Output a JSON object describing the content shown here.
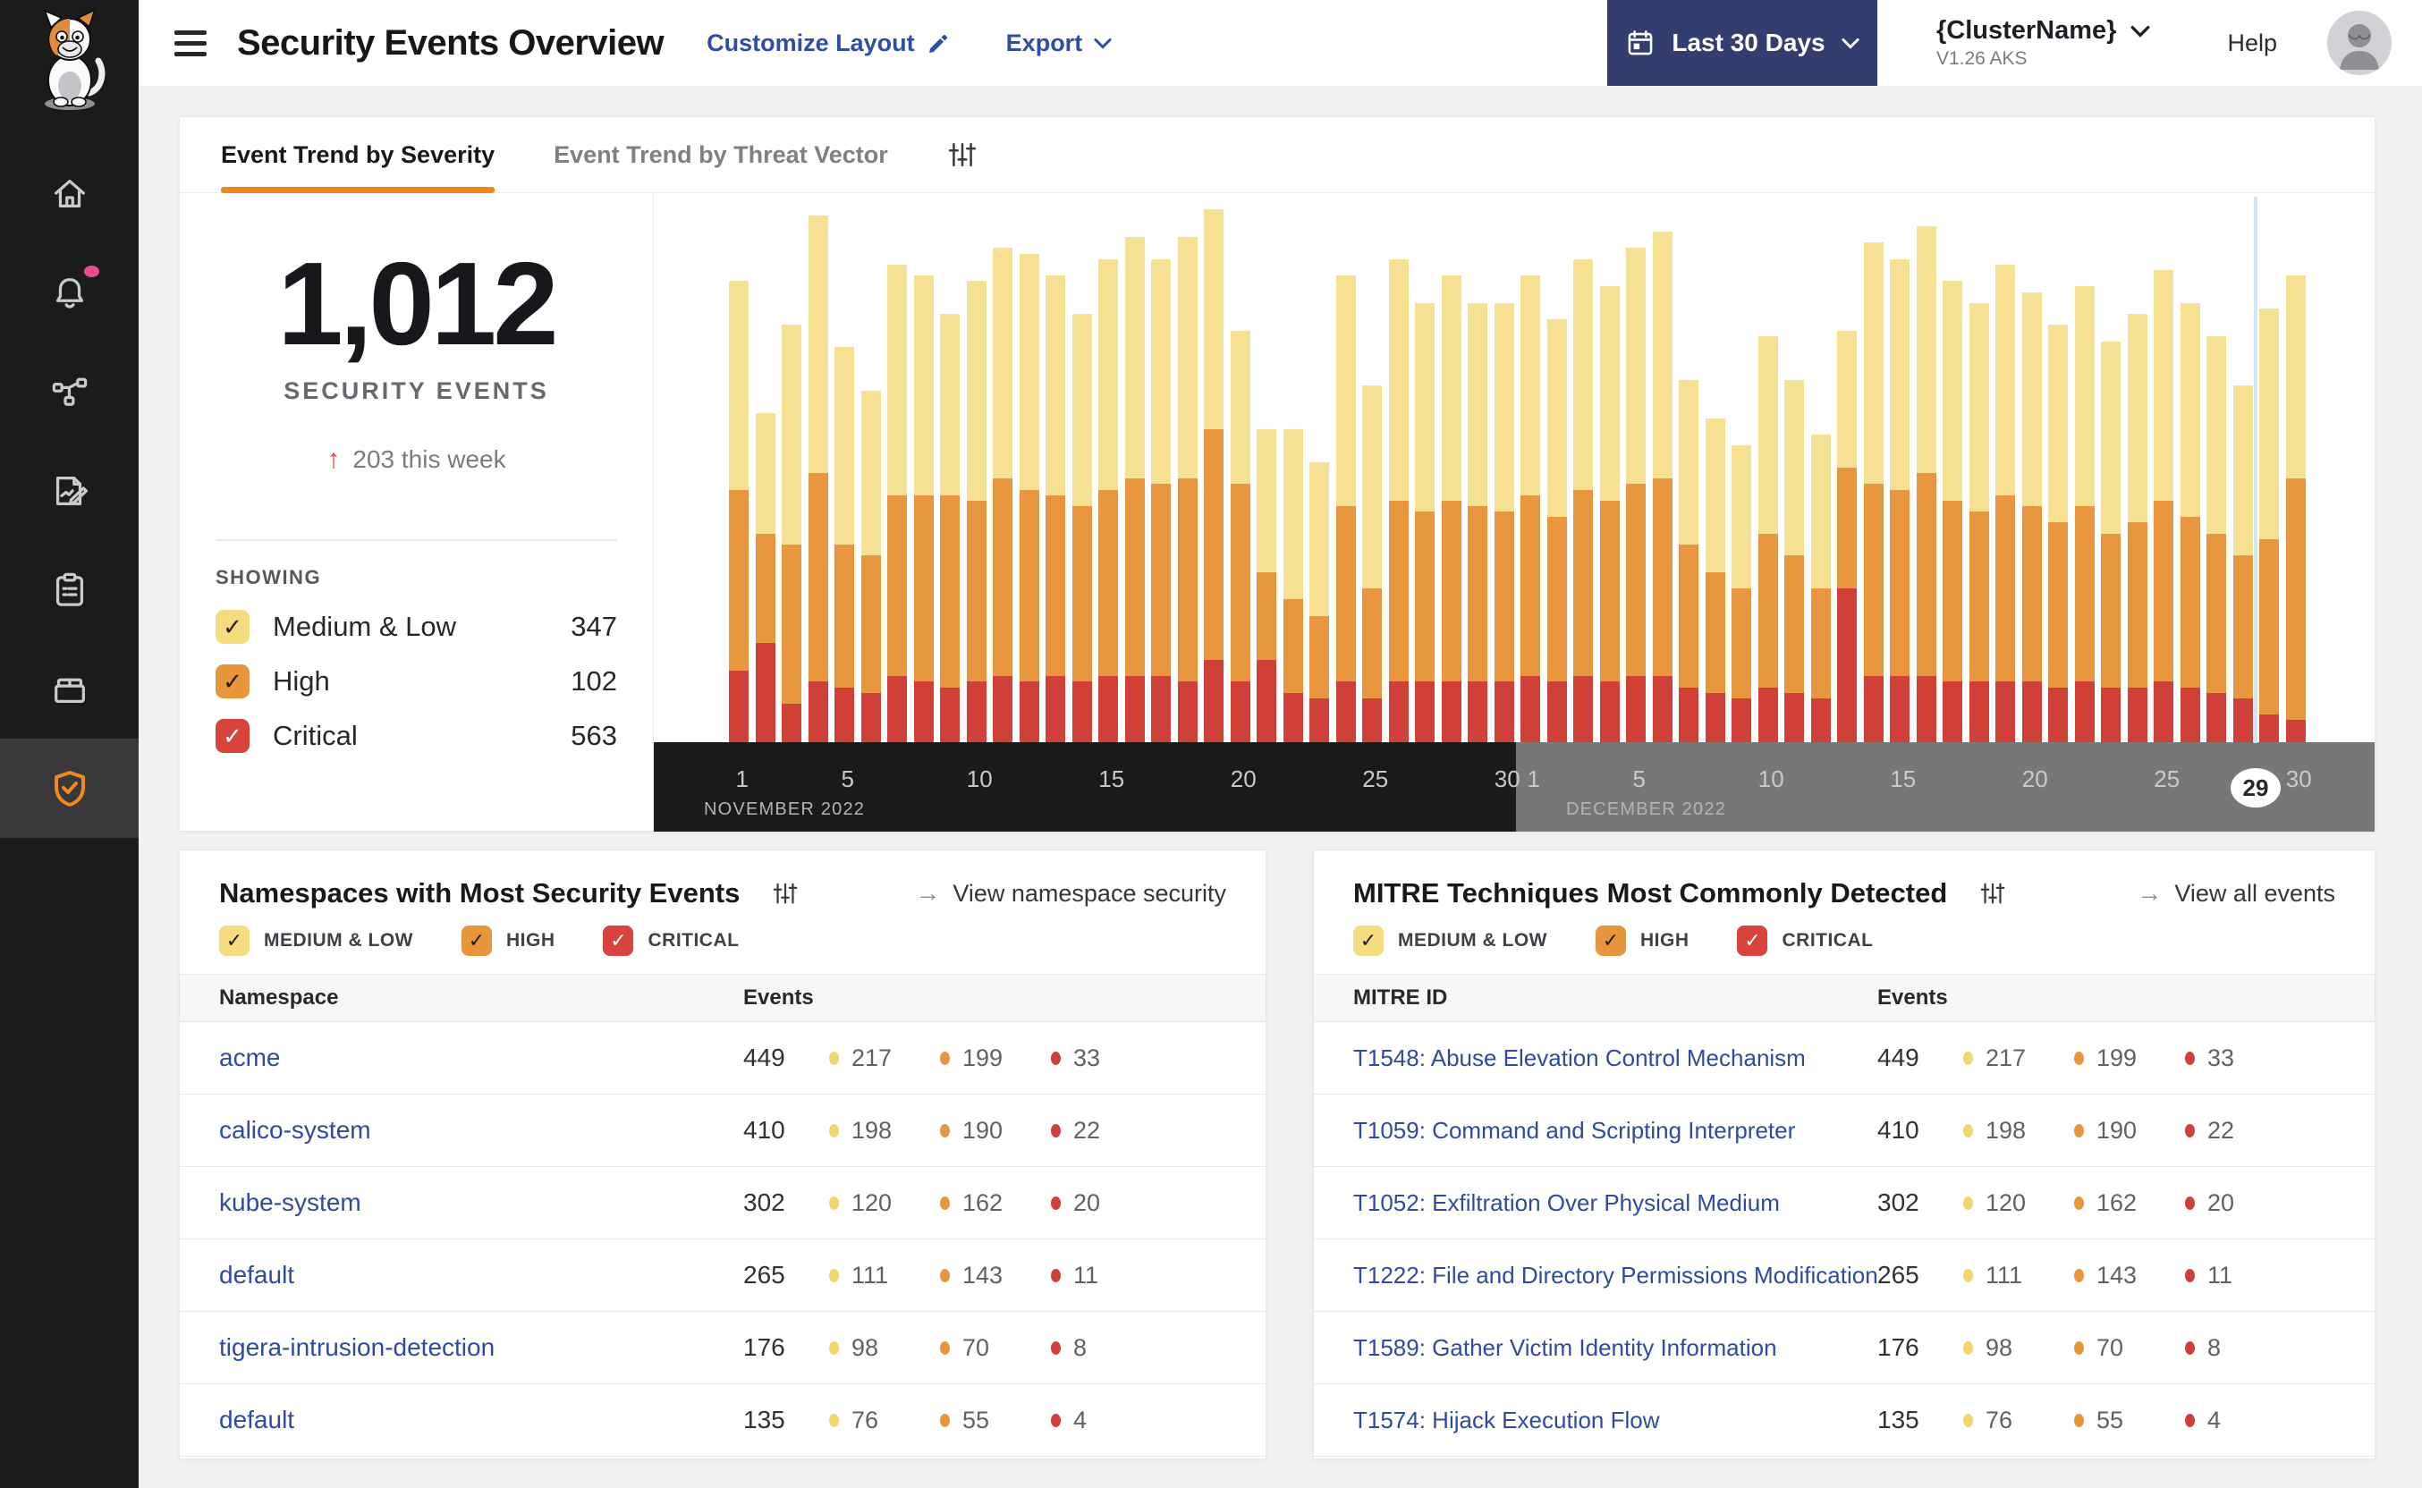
{
  "header": {
    "title": "Security Events Overview",
    "customize_label": "Customize Layout",
    "export_label": "Export",
    "date_range_label": "Last 30 Days",
    "cluster_name": "{ClusterName}",
    "cluster_version": "V1.26 AKS",
    "help_label": "Help"
  },
  "sidebar": {
    "icons": [
      "calico-cat-logo",
      "home",
      "alerts-bell",
      "service-graph",
      "report-edit",
      "clipboard",
      "workload-box",
      "threat-defense-shield"
    ],
    "active_icon": "threat-defense-shield"
  },
  "tabs": {
    "severity": "Event Trend by Severity",
    "threat_vector": "Event Trend by Threat Vector"
  },
  "stats": {
    "total": "1,012",
    "total_label": "SECURITY EVENTS",
    "delta_arrow": "↑",
    "delta_text": "203 this week",
    "showing_label": "SHOWING",
    "rows": [
      {
        "id": "medium_low",
        "label": "Medium & Low",
        "value": "347"
      },
      {
        "id": "high",
        "label": "High",
        "value": "102"
      },
      {
        "id": "critical",
        "label": "Critical",
        "value": "563"
      }
    ]
  },
  "severity_filters": [
    {
      "id": "medium_low",
      "label": "MEDIUM & LOW",
      "box": "#F5DC7E",
      "check": "#1D1D1D",
      "checked": true
    },
    {
      "id": "high",
      "label": "HIGH",
      "box": "#E8963C",
      "check": "#1D1D1D",
      "checked": true
    },
    {
      "id": "critical",
      "label": "CRITICAL",
      "box": "#D8433C",
      "check": "#FFFFFF",
      "checked": true
    }
  ],
  "chart_data": {
    "type": "bar",
    "subtype": "stacked_daily",
    "title": "Event Trend by Severity",
    "unit": "percent_of_plot_height",
    "stack_order_bottom_to_top": [
      "critical",
      "high",
      "medium_low"
    ],
    "legend": {
      "medium_low": "Medium & Low",
      "high": "High",
      "critical": "Critical"
    },
    "months": [
      {
        "label": "NOVEMBER 2022",
        "days": 30,
        "ticks": [
          1,
          5,
          10,
          15,
          20,
          25,
          30
        ]
      },
      {
        "label": "DECEMBER 2022",
        "days": 31,
        "ticks": [
          1,
          5,
          10,
          15,
          20,
          25,
          30
        ],
        "marker_day": 29
      }
    ],
    "series": {
      "medium_low": [
        38,
        22,
        40,
        47,
        36,
        30,
        42,
        40,
        33,
        40,
        42,
        43,
        40,
        35,
        42,
        44,
        41,
        44,
        40,
        28,
        26,
        31,
        28,
        42,
        37,
        44,
        38,
        41,
        37,
        38,
        40,
        36,
        42,
        39,
        43,
        45,
        30,
        28,
        26,
        36,
        32,
        28,
        25,
        44,
        42,
        45,
        40,
        38,
        42,
        39,
        36,
        40,
        35,
        38,
        42,
        39,
        36,
        31,
        42,
        37
      ],
      "high": [
        33,
        20,
        29,
        38,
        26,
        25,
        33,
        34,
        35,
        33,
        36,
        35,
        33,
        32,
        34,
        36,
        35,
        37,
        42,
        36,
        16,
        17,
        15,
        32,
        20,
        33,
        31,
        33,
        32,
        31,
        33,
        30,
        34,
        33,
        35,
        36,
        26,
        22,
        20,
        28,
        25,
        20,
        22,
        35,
        34,
        37,
        33,
        31,
        34,
        32,
        30,
        32,
        28,
        30,
        33,
        31,
        29,
        26,
        32,
        44
      ],
      "critical": [
        13,
        18,
        7,
        11,
        10,
        9,
        12,
        11,
        10,
        11,
        12,
        11,
        12,
        11,
        12,
        12,
        12,
        11,
        15,
        11,
        15,
        9,
        8,
        11,
        8,
        11,
        11,
        11,
        11,
        11,
        12,
        11,
        12,
        11,
        12,
        12,
        10,
        9,
        8,
        10,
        9,
        8,
        28,
        12,
        12,
        12,
        11,
        11,
        11,
        11,
        10,
        11,
        10,
        10,
        11,
        10,
        9,
        8,
        5,
        4
      ]
    }
  },
  "namespaces_panel": {
    "title": "Namespaces with Most Security Events",
    "action_label": "View namespace security",
    "action_arrow": "→",
    "columns": {
      "name": "Namespace",
      "events": "Events"
    },
    "rows": [
      {
        "name": "acme",
        "total": "449",
        "medium_low": "217",
        "high": "199",
        "critical": "33"
      },
      {
        "name": "calico-system",
        "total": "410",
        "medium_low": "198",
        "high": "190",
        "critical": "22"
      },
      {
        "name": "kube-system",
        "total": "302",
        "medium_low": "120",
        "high": "162",
        "critical": "20"
      },
      {
        "name": "default",
        "total": "265",
        "medium_low": "111",
        "high": "143",
        "critical": "11"
      },
      {
        "name": "tigera-intrusion-detection",
        "total": "176",
        "medium_low": "98",
        "high": "70",
        "critical": "8"
      },
      {
        "name": "default",
        "total": "135",
        "medium_low": "76",
        "high": "55",
        "critical": "4"
      }
    ]
  },
  "mitre_panel": {
    "title": "MITRE Techniques Most Commonly Detected",
    "action_label": "View all events",
    "action_arrow": "→",
    "columns": {
      "name": "MITRE ID",
      "events": "Events"
    },
    "rows": [
      {
        "name": "T1548: Abuse Elevation Control Mechanism",
        "total": "449",
        "medium_low": "217",
        "high": "199",
        "critical": "33"
      },
      {
        "name": "T1059: Command and Scripting Interpreter",
        "total": "410",
        "medium_low": "198",
        "high": "190",
        "critical": "22"
      },
      {
        "name": "T1052: Exfiltration Over Physical Medium",
        "total": "302",
        "medium_low": "120",
        "high": "162",
        "critical": "20"
      },
      {
        "name": "T1222: File and Directory Permissions Modification",
        "total": "265",
        "medium_low": "111",
        "high": "143",
        "critical": "11"
      },
      {
        "name": "T1589: Gather Victim Identity Information",
        "total": "176",
        "medium_low": "98",
        "high": "70",
        "critical": "8"
      },
      {
        "name": "T1574: Hijack Execution Flow",
        "total": "135",
        "medium_low": "76",
        "high": "55",
        "critical": "4"
      }
    ]
  },
  "colors": {
    "accent_orange": "#F0871C",
    "medium_low_bar": "#F5E093",
    "high_bar": "#E8973E",
    "critical_bar": "#D04038",
    "dot_medium_low": "#F2D66B",
    "dot_high": "#E8963C",
    "dot_critical": "#D23F3B",
    "link_blue": "#3049A1",
    "header_link_blue": "#2F4DA7",
    "button_navy": "#343D70",
    "sidebar_bg": "#1B1B1D",
    "band_november": "#1A1A1B",
    "band_december": "#777779",
    "now_line": "#CFE6F4",
    "notification_pink": "#EC4C8D",
    "page_bg": "#F1F1F2"
  }
}
